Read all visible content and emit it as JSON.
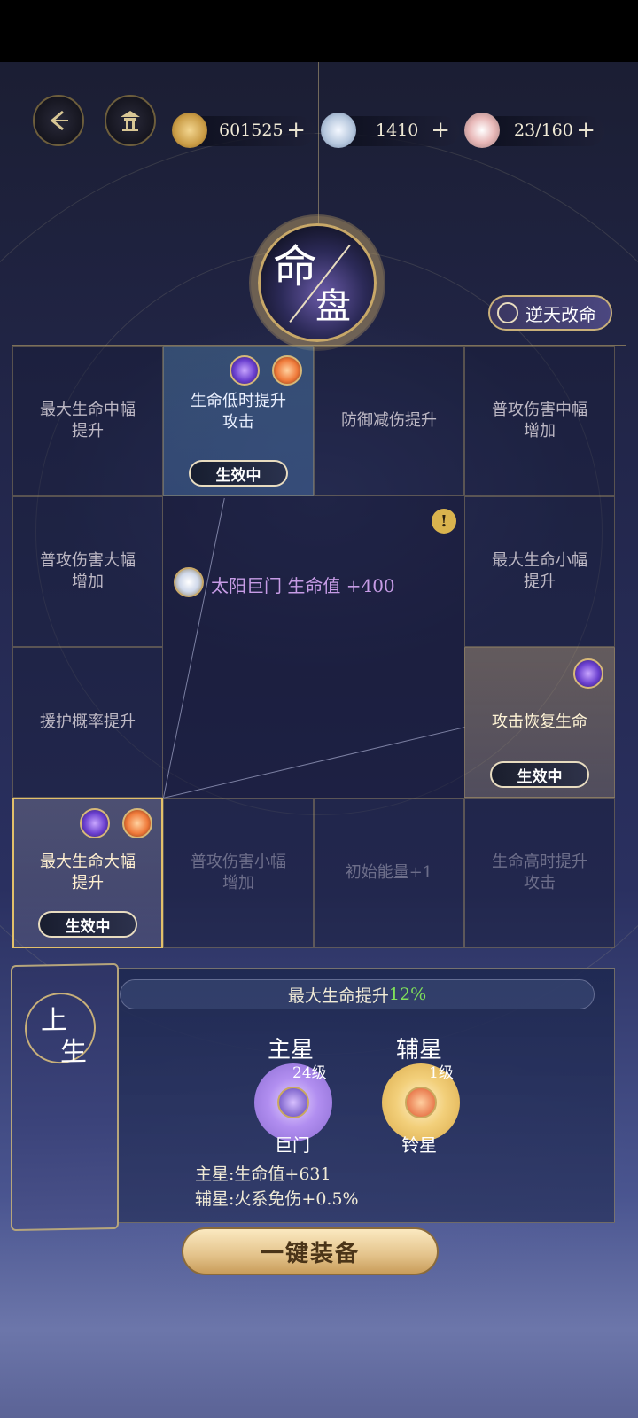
{
  "resources": [
    {
      "name": "copper-coin",
      "value": "601525",
      "plus": "+"
    },
    {
      "name": "jade-orb",
      "value": "1410",
      "plus": "+"
    },
    {
      "name": "food-bowl",
      "value": "23/160",
      "plus": "+"
    }
  ],
  "emblem": {
    "char1": "命",
    "char2": "盘"
  },
  "nitian_button": "逆天改命",
  "grid": {
    "cells": [
      {
        "label": "最大生命中幅\n提升"
      },
      {
        "label": "生命低时提升\n攻击",
        "badge": "生效中"
      },
      {
        "label": "防御减伤提升"
      },
      {
        "label": "普攻伤害中幅\n增加"
      },
      {
        "label": "普攻伤害大幅\n增加"
      },
      {
        "label": "最大生命小幅\n提升"
      },
      {
        "label": "援护概率提升"
      },
      {
        "label": "攻击恢复生命",
        "badge": "生效中"
      },
      {
        "label": "最大生命大幅\n提升",
        "badge": "生效中"
      },
      {
        "label": "普攻伤害小幅\n增加"
      },
      {
        "label": "初始能量+1"
      },
      {
        "label": "生命高时提升\n攻击"
      }
    ],
    "center_text": "太阳巨门 生命值 +400",
    "warn_symbol": "!"
  },
  "left_card": {
    "t1": "上",
    "t2": "生"
  },
  "bonus": {
    "label": "最大生命提升",
    "pct": "12%"
  },
  "main_star": {
    "title": "主星",
    "level": "24级",
    "name": "巨门"
  },
  "aux_star": {
    "title": "辅星",
    "level": "1级",
    "name": "铃星"
  },
  "effects": [
    "主星:生命值+631",
    "辅星:火系免伤+0.5%"
  ],
  "equip_button": "一键装备",
  "colors": {
    "accent_gold": "#c8a868",
    "green_pct": "#7fe05a",
    "center_purple": "#c79ce6"
  }
}
